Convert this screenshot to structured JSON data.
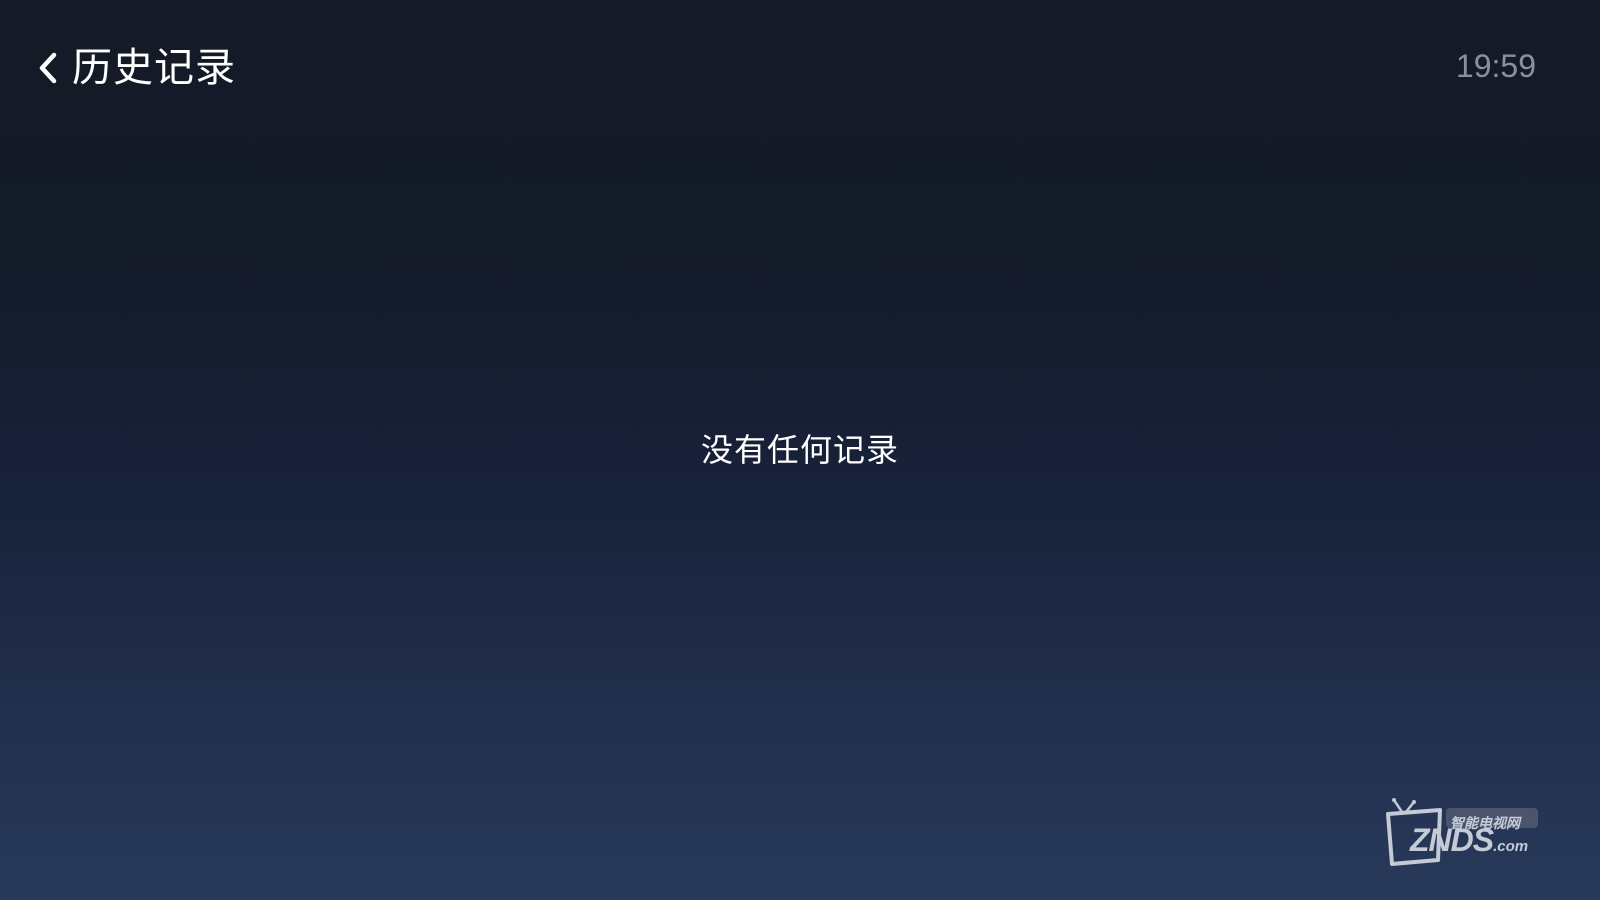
{
  "header": {
    "back_icon": "chevron-left-icon",
    "title": "历史记录",
    "time": "19:59"
  },
  "main": {
    "empty_message": "没有任何记录"
  },
  "watermark": {
    "icon": "tv-icon",
    "cn_text": "智能电视网",
    "brand": "ZNDS",
    "suffix": ".com"
  },
  "colors": {
    "background_top": "#141a26",
    "background_bottom": "#28395a",
    "clock": "#8a909c",
    "text": "#ffffff"
  }
}
